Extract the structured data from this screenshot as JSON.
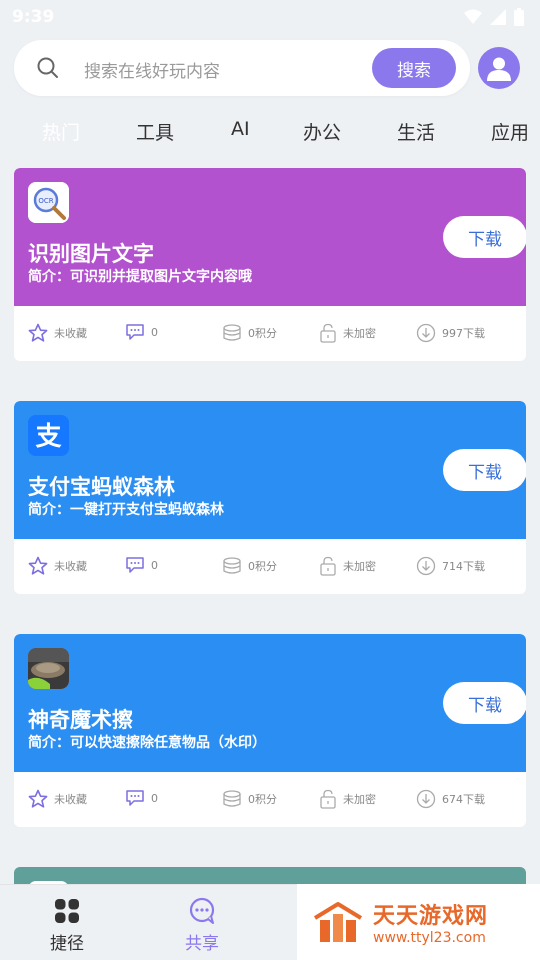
{
  "status_bar": {
    "time": "9:39"
  },
  "search": {
    "placeholder": "搜索在线好玩内容",
    "button_label": "搜索"
  },
  "tabs": [
    "热门",
    "工具",
    "AI",
    "办公",
    "生活",
    "应用"
  ],
  "active_tab": "热门",
  "cards": [
    {
      "name": "识别图片文字",
      "intro": "简介：可识别并提取图片文字内容哦",
      "color": "#b352cf",
      "icon": "ocr-icon",
      "download_label": "下载",
      "favorite": "未收藏",
      "comments": "0",
      "points": "0积分",
      "encryption": "未加密",
      "downloads": "997下载"
    },
    {
      "name": "支付宝蚂蚁森林",
      "intro": "简介：一键打开支付宝蚂蚁森林",
      "color": "#2a8ef3",
      "icon": "alipay-icon",
      "download_label": "下载",
      "favorite": "未收藏",
      "comments": "0",
      "points": "0积分",
      "encryption": "未加密",
      "downloads": "714下载"
    },
    {
      "name": "神奇魔术擦",
      "intro": "简介：可以快速擦除任意物品（水印）",
      "color": "#2a8ef3",
      "icon": "magic-eraser-icon",
      "download_label": "下载",
      "favorite": "未收藏",
      "comments": "0",
      "points": "0积分",
      "encryption": "未加密",
      "downloads": "674下载"
    }
  ],
  "bottom_nav": [
    {
      "label": "捷径",
      "icon": "grid-icon",
      "active": false
    },
    {
      "label": "共享",
      "icon": "chat-icon",
      "active": true
    }
  ],
  "watermark": {
    "title": "天天游戏网",
    "url": "www.ttyl23.com"
  },
  "colors": {
    "accent": "#8a78ec",
    "background": "#eef1f4",
    "partial_card": "#5fa09a"
  }
}
